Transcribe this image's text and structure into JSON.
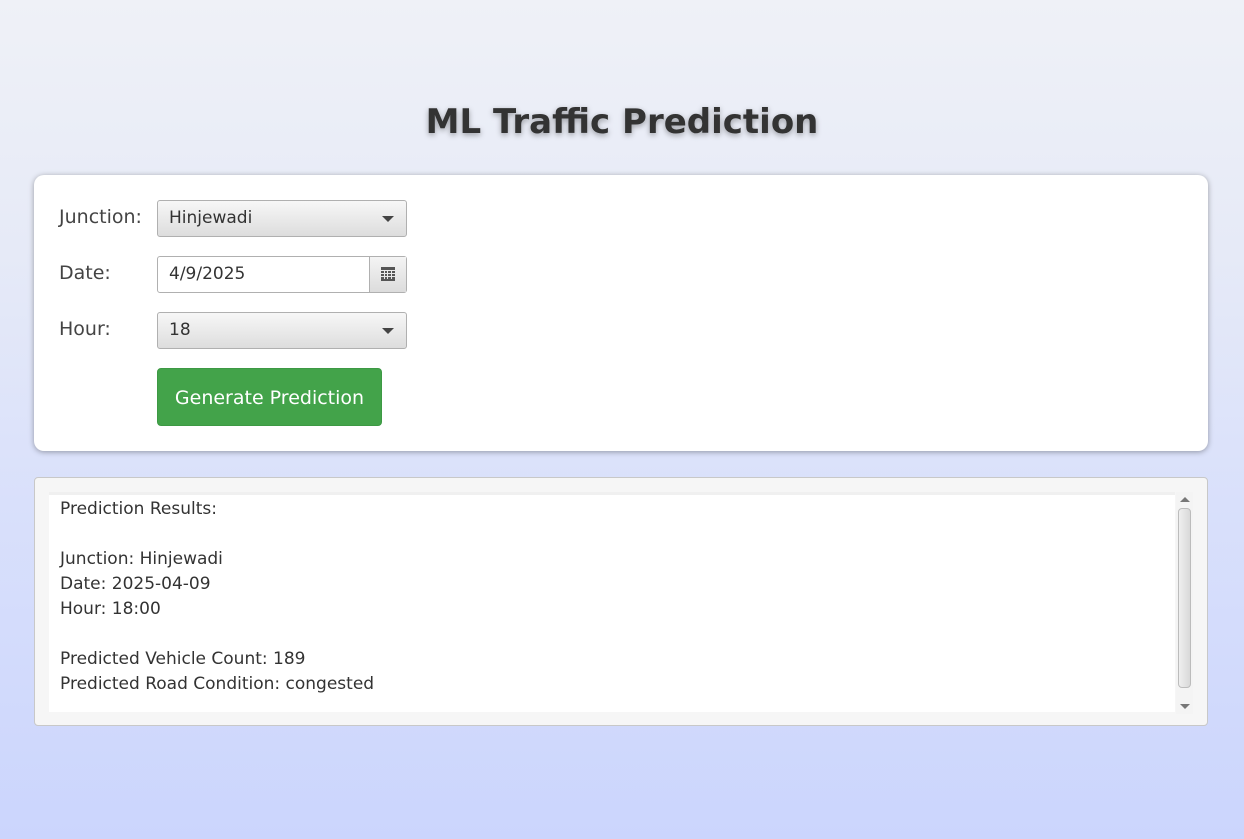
{
  "app": {
    "title": "ML Traffic Prediction"
  },
  "form": {
    "junction_label": "Junction:",
    "junction_value": "Hinjewadi",
    "date_label": "Date:",
    "date_value": "4/9/2025",
    "hour_label": "Hour:",
    "hour_value": "18",
    "generate_button": "Generate Prediction"
  },
  "results": {
    "lines": [
      "Prediction Results:",
      "",
      "Junction: Hinjewadi",
      "Date: 2025-04-09",
      "Hour: 18:00",
      "",
      "Predicted Vehicle Count: 189",
      "Predicted Road Condition: congested"
    ]
  },
  "colors": {
    "accent_button": "#43a34a",
    "background_top": "#eff1f7",
    "background_bottom": "#cbd5fd"
  },
  "icons": {
    "calendar": "calendar-icon",
    "dropdown": "chevron-down-icon"
  }
}
